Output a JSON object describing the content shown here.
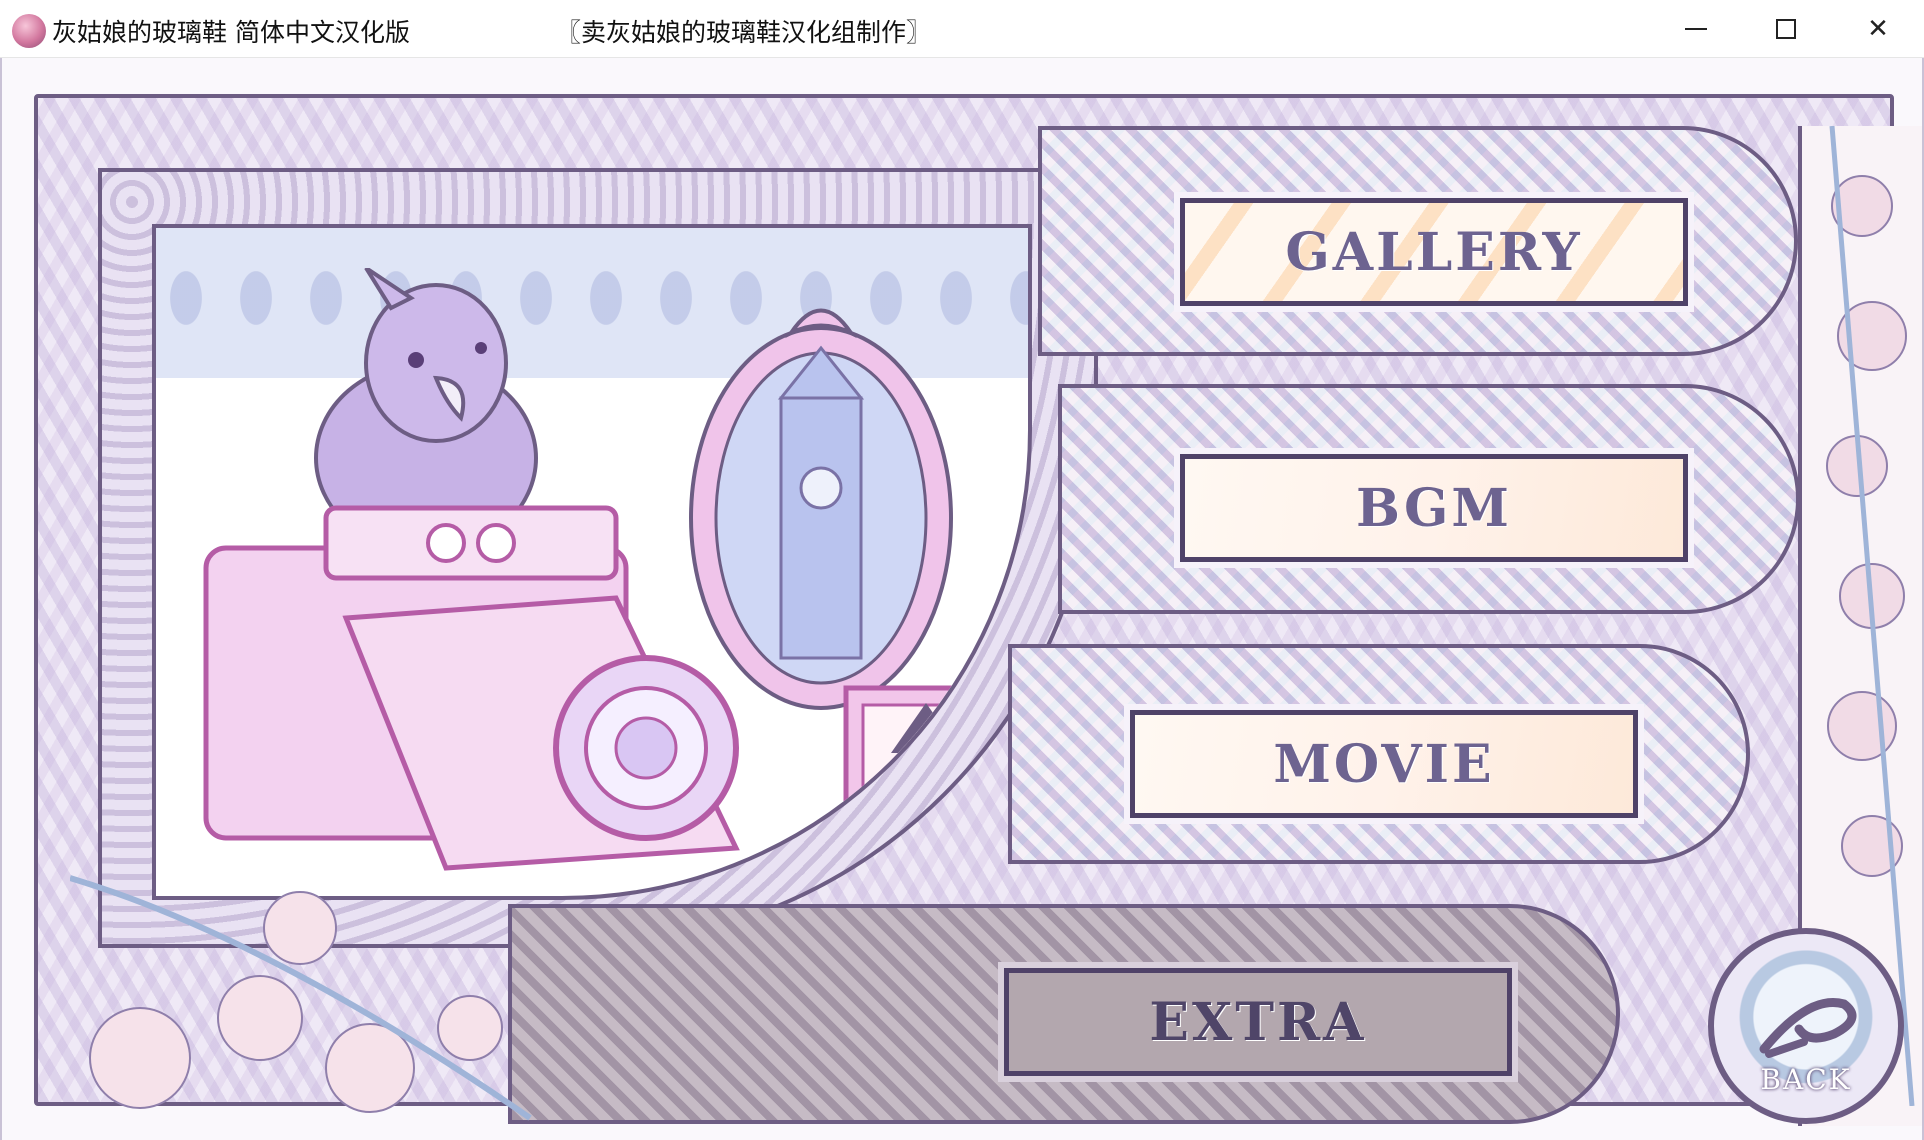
{
  "window": {
    "title": "灰姑娘的玻璃鞋 简体中文汉化版",
    "credit": "〖卖灰姑娘的玻璃鞋汉化组制作〗",
    "minimize_glyph": "",
    "close_glyph": "✕"
  },
  "menu": {
    "items": [
      {
        "label": "GALLERY"
      },
      {
        "label": "BGM"
      },
      {
        "label": "MOVIE"
      },
      {
        "label": "EXTRA"
      }
    ],
    "selected": "EXTRA"
  },
  "back": {
    "label": "BACK"
  },
  "colors": {
    "frame": "#6d5d84",
    "button_text": "#6d6390",
    "button_face": "#fff2ea",
    "selected_face": "#b3a7ae",
    "accent_pink": "#e39ad0",
    "accent_lilac": "#c8b4e6"
  },
  "icons": [
    "app-icon",
    "minimize-icon",
    "maximize-icon",
    "close-icon",
    "back-arrow-icon"
  ]
}
